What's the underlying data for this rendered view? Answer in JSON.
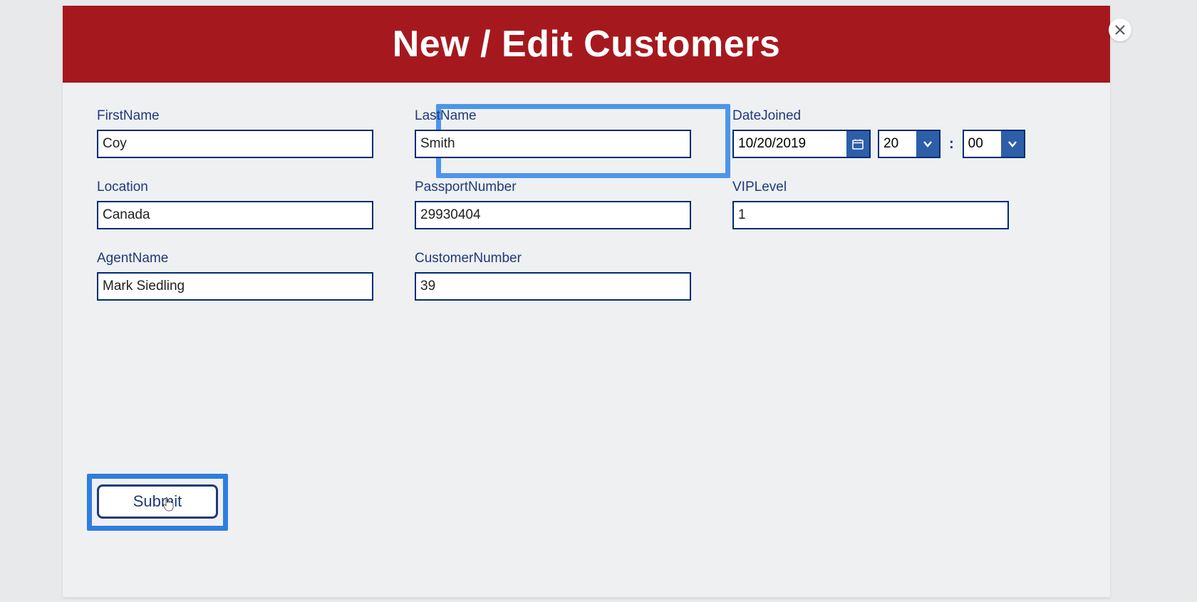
{
  "header": {
    "title": "New / Edit Customers"
  },
  "fields": {
    "firstName": {
      "label": "FirstName",
      "value": "Coy"
    },
    "lastName": {
      "label": "LastName",
      "value": "Smith"
    },
    "dateJoined": {
      "label": "DateJoined",
      "date": "10/20/2019",
      "hour": "20",
      "minute": "00"
    },
    "location": {
      "label": "Location",
      "value": "Canada"
    },
    "passportNumber": {
      "label": "PassportNumber",
      "value": "29930404"
    },
    "vipLevel": {
      "label": "VIPLevel",
      "value": "1"
    },
    "agentName": {
      "label": "AgentName",
      "value": "Mark Siedling"
    },
    "customerNumber": {
      "label": "CustomerNumber",
      "value": "39"
    }
  },
  "time": {
    "separator": ":"
  },
  "buttons": {
    "submit": "Submit"
  }
}
